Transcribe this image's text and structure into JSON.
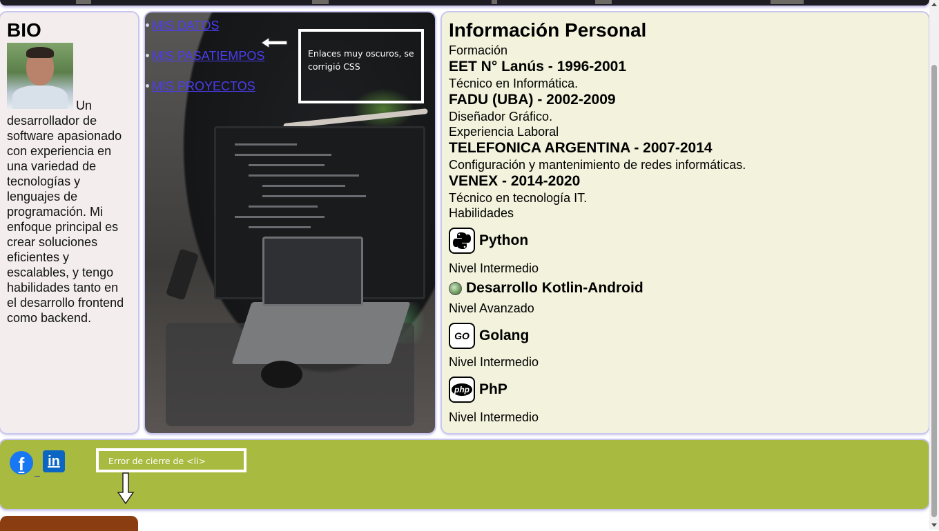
{
  "bio": {
    "title": "BIO",
    "photo_icon": "profile-photo",
    "text": "Un desarrollador de software apasionado con experiencia en una variedad de tecnologías y lenguajes de programación. Mi enfoque principal es crear soluciones eficientes y escalables, y tengo habilidades tanto en el desarrollo frontend como backend."
  },
  "nav": {
    "items": [
      {
        "label": "MIS DATOS"
      },
      {
        "label": "MIS PASATIEMPOS"
      },
      {
        "label": "MIS PROYECTOS"
      }
    ],
    "link_color": "#4b3df0"
  },
  "annotations": {
    "css_note": "Enlaces muy oscuros, se corrigió CSS",
    "li_note": "Error de cierre de <li>"
  },
  "info": {
    "title": "Información Personal",
    "formacion_label": "Formación",
    "education": [
      {
        "place": "EET N° Lanús - 1996-2001",
        "degree": "Técnico en Informática."
      },
      {
        "place": "FADU (UBA) - 2002-2009",
        "degree": "Diseñador Gráfico."
      }
    ],
    "experiencia_label": "Experiencia Laboral",
    "jobs": [
      {
        "company": "TELEFONICA ARGENTINA - 2007-2014",
        "role": "Configuración y mantenimiento de redes informáticas."
      },
      {
        "company": "VENEX - 2014-2020",
        "role": "Técnico en tecnología IT."
      }
    ],
    "habilidades_label": "Habilidades",
    "skills": [
      {
        "name": "Python",
        "level": "Nivel Intermedio",
        "icon": "python-icon"
      },
      {
        "name": "Desarrollo Kotlin-Android",
        "level": "Nivel Avanzado",
        "icon": "android-globe-icon"
      },
      {
        "name": "Golang",
        "level": "Nivel Intermedio",
        "icon": "golang-icon",
        "icon_text": "GO"
      },
      {
        "name": "PhP",
        "level": "Nivel Intermedio",
        "icon": "php-icon",
        "icon_text": "php"
      }
    ]
  },
  "footer": {
    "facebook_glyph": "f",
    "linkedin_glyph": "in",
    "bg_color": "#a8ba3f"
  },
  "colors": {
    "bio_bg": "#f3edee",
    "info_bg": "#f3f2dc",
    "bottom_tab": "#8b3d12"
  }
}
